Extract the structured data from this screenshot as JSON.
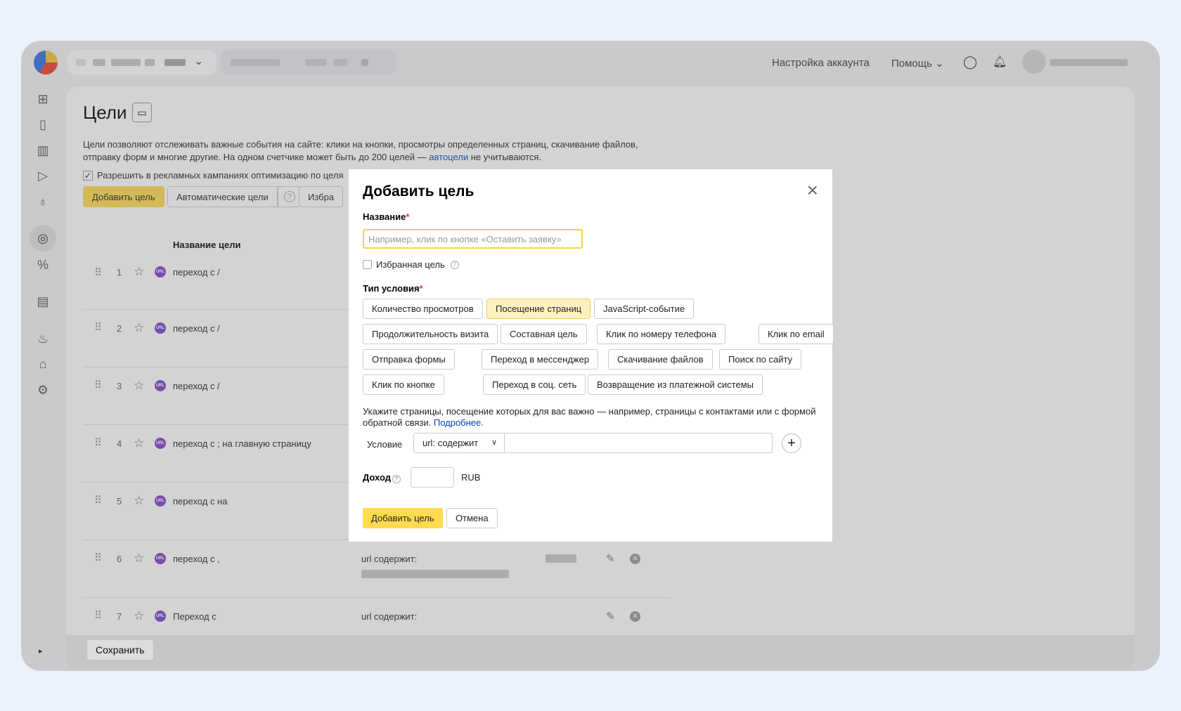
{
  "header": {
    "account_settings": "Настройка аккаунта",
    "help": "Помощь"
  },
  "page": {
    "title": "Цели",
    "description_part1": "Цели позволяют отслеживать важные события на сайте: клики на кнопки, просмотры определенных страниц, скачивание файлов, отправку форм и многие другие. На одном счетчике может быть до 200 целей — ",
    "description_link": "автоцели",
    "description_part2": " не учитываются.",
    "allow_label": "Разрешить в рекламных кампаниях оптимизацию по целя",
    "add_goal_button": "Добавить цель",
    "auto_goals_button": "Автоматические цели",
    "favorites_button": "Избра",
    "column_goal_name": "Название цели",
    "save_button": "Сохранить"
  },
  "goals": [
    {
      "num": "1",
      "name": "переход с /",
      "condition": ""
    },
    {
      "num": "2",
      "name": "переход с /",
      "condition": ""
    },
    {
      "num": "3",
      "name": "переход с /",
      "condition": ""
    },
    {
      "num": "4",
      "name": "переход с ; на главную страницу",
      "condition": ""
    },
    {
      "num": "5",
      "name": "переход с на",
      "condition": ""
    },
    {
      "num": "6",
      "name": "переход с ,",
      "condition": "url содержит:"
    },
    {
      "num": "7",
      "name": "Переход с",
      "condition": "url содержит:"
    }
  ],
  "modal": {
    "title": "Добавить цель",
    "name_label": "Название",
    "name_placeholder": "Например, клик по кнопке «Оставить заявку»",
    "favorite_label": "Избранная цель",
    "condition_type_label": "Тип условия",
    "chips": [
      "Количество просмотров",
      "Посещение страниц",
      "JavaScript-событие",
      "Продолжительность визита",
      "Составная цель",
      "Клик по номеру телефона",
      "Клик по email",
      "Отправка формы",
      "Переход в мессенджер",
      "Скачивание файлов",
      "Поиск по сайту",
      "Клик по кнопке",
      "Переход в соц. сеть",
      "Возвращение из платежной системы"
    ],
    "selected_chip": "Посещение страниц",
    "hint_text": "Укажите страницы, посещение которых для вас важно — например, страницы с контактами или с формой обратной связи. ",
    "hint_link": "Подробнее",
    "hint_end": ".",
    "condition_label": "Условие",
    "condition_select": "url: содержит",
    "income_label": "Доход",
    "currency": "RUB",
    "add_button": "Добавить цель",
    "cancel_button": "Отмена"
  },
  "colors": {
    "accent_yellow": "#ffdb4d",
    "link_blue": "#0044bb",
    "url_badge": "#7b3fc9"
  }
}
